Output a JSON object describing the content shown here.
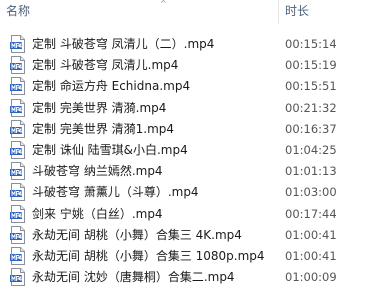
{
  "header": {
    "name_label": "名称",
    "sort_indicator": "^",
    "duration_label": "时长"
  },
  "icon_name": "mp4-file-icon",
  "files": [
    {
      "name": "定制 斗破苍穹 凤清儿（二）.mp4",
      "duration": "00:15:14"
    },
    {
      "name": "定制 斗破苍穹 凤清儿.mp4",
      "duration": "00:15:19"
    },
    {
      "name": "定制 命运方舟 Echidna.mp4",
      "duration": "00:15:51"
    },
    {
      "name": "定制 完美世界 清漪.mp4",
      "duration": "00:21:32"
    },
    {
      "name": "定制 完美世界 清漪1.mp4",
      "duration": "00:16:37"
    },
    {
      "name": "定制 诛仙 陆雪琪&小白.mp4",
      "duration": "01:04:25"
    },
    {
      "name": "斗破苍穹 纳兰嫣然.mp4",
      "duration": "01:01:13"
    },
    {
      "name": "斗破苍穹 萧薰儿（斗尊）.mp4",
      "duration": "01:03:00"
    },
    {
      "name": "剑来 宁姚（白丝）.mp4",
      "duration": "00:17:44"
    },
    {
      "name": "永劫无间 胡桃（小舞）合集三 4K.mp4",
      "duration": "01:00:41"
    },
    {
      "name": "永劫无间 胡桃（小舞）合集三 1080p.mp4",
      "duration": "01:00:41"
    },
    {
      "name": "永劫无间 沈妙（唐舞桐）合集二.mp4",
      "duration": "01:00:09"
    }
  ]
}
